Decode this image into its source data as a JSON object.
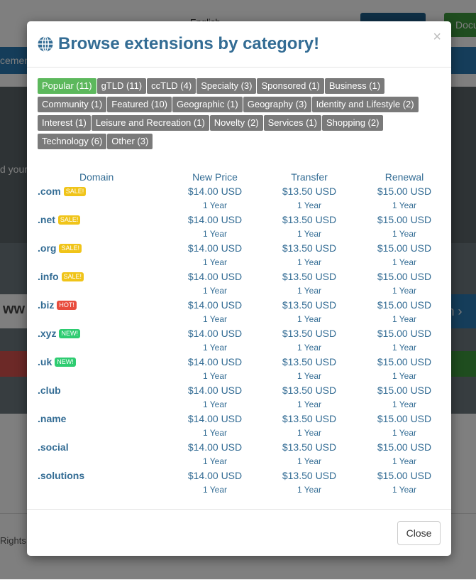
{
  "background": {
    "nav_text": "cement",
    "language_text": "English",
    "docs_button": "Docu",
    "hero_text": "d your",
    "search_text": "ww",
    "search_go": "h ›",
    "footer_text": "Rights"
  },
  "modal": {
    "title": "Browse extensions by category!",
    "close_icon": "×",
    "categories": [
      {
        "label": "Popular (11)",
        "active": true
      },
      {
        "label": "gTLD (11)",
        "active": false
      },
      {
        "label": "ccTLD (4)",
        "active": false
      },
      {
        "label": "Specialty (3)",
        "active": false
      },
      {
        "label": "Sponsored (1)",
        "active": false
      },
      {
        "label": "Business (1)",
        "active": false
      },
      {
        "label": "Community (1)",
        "active": false
      },
      {
        "label": "Featured (10)",
        "active": false
      },
      {
        "label": "Geographic (1)",
        "active": false
      },
      {
        "label": "Geography (3)",
        "active": false
      },
      {
        "label": "Identity and Lifestyle (2)",
        "active": false
      },
      {
        "label": "Interest (1)",
        "active": false
      },
      {
        "label": "Leisure and Recreation (1)",
        "active": false
      },
      {
        "label": "Novelty (2)",
        "active": false
      },
      {
        "label": "Services (1)",
        "active": false
      },
      {
        "label": "Shopping (2)",
        "active": false
      },
      {
        "label": "Technology (6)",
        "active": false
      },
      {
        "label": "Other (3)",
        "active": false
      }
    ],
    "table": {
      "headers": {
        "domain": "Domain",
        "new_price": "New Price",
        "transfer": "Transfer",
        "renewal": "Renewal"
      },
      "rows": [
        {
          "tld": ".com",
          "badge": "SALE!",
          "badge_type": "sale",
          "new_price": "$14.00 USD",
          "new_term": "1 Year",
          "transfer": "$13.50 USD",
          "transfer_term": "1 Year",
          "renewal": "$15.00 USD",
          "renewal_term": "1 Year"
        },
        {
          "tld": ".net",
          "badge": "SALE!",
          "badge_type": "sale",
          "new_price": "$14.00 USD",
          "new_term": "1 Year",
          "transfer": "$13.50 USD",
          "transfer_term": "1 Year",
          "renewal": "$15.00 USD",
          "renewal_term": "1 Year"
        },
        {
          "tld": ".org",
          "badge": "SALE!",
          "badge_type": "sale",
          "new_price": "$14.00 USD",
          "new_term": "1 Year",
          "transfer": "$13.50 USD",
          "transfer_term": "1 Year",
          "renewal": "$15.00 USD",
          "renewal_term": "1 Year"
        },
        {
          "tld": ".info",
          "badge": "SALE!",
          "badge_type": "sale",
          "new_price": "$14.00 USD",
          "new_term": "1 Year",
          "transfer": "$13.50 USD",
          "transfer_term": "1 Year",
          "renewal": "$15.00 USD",
          "renewal_term": "1 Year"
        },
        {
          "tld": ".biz",
          "badge": "HOT!",
          "badge_type": "hot",
          "new_price": "$14.00 USD",
          "new_term": "1 Year",
          "transfer": "$13.50 USD",
          "transfer_term": "1 Year",
          "renewal": "$15.00 USD",
          "renewal_term": "1 Year"
        },
        {
          "tld": ".xyz",
          "badge": "NEW!",
          "badge_type": "new",
          "new_price": "$14.00 USD",
          "new_term": "1 Year",
          "transfer": "$13.50 USD",
          "transfer_term": "1 Year",
          "renewal": "$15.00 USD",
          "renewal_term": "1 Year"
        },
        {
          "tld": ".uk",
          "badge": "NEW!",
          "badge_type": "new",
          "new_price": "$14.00 USD",
          "new_term": "1 Year",
          "transfer": "$13.50 USD",
          "transfer_term": "1 Year",
          "renewal": "$15.00 USD",
          "renewal_term": "1 Year"
        },
        {
          "tld": ".club",
          "badge": "",
          "badge_type": "",
          "new_price": "$14.00 USD",
          "new_term": "1 Year",
          "transfer": "$13.50 USD",
          "transfer_term": "1 Year",
          "renewal": "$15.00 USD",
          "renewal_term": "1 Year"
        },
        {
          "tld": ".name",
          "badge": "",
          "badge_type": "",
          "new_price": "$14.00 USD",
          "new_term": "1 Year",
          "transfer": "$13.50 USD",
          "transfer_term": "1 Year",
          "renewal": "$15.00 USD",
          "renewal_term": "1 Year"
        },
        {
          "tld": ".social",
          "badge": "",
          "badge_type": "",
          "new_price": "$14.00 USD",
          "new_term": "1 Year",
          "transfer": "$13.50 USD",
          "transfer_term": "1 Year",
          "renewal": "$15.00 USD",
          "renewal_term": "1 Year"
        },
        {
          "tld": ".solutions",
          "badge": "",
          "badge_type": "",
          "new_price": "$14.00 USD",
          "new_term": "1 Year",
          "transfer": "$13.50 USD",
          "transfer_term": "1 Year",
          "renewal": "$15.00 USD",
          "renewal_term": "1 Year"
        }
      ]
    },
    "close_button": "Close"
  },
  "colors": {
    "title": "#336c94",
    "active_category": "#5cb85c",
    "category": "#7a7a7a",
    "badge_sale": "#f0c419",
    "badge_hot": "#e84c3d",
    "badge_new": "#2ecc71"
  },
  "icons": {
    "title_icon": "globe-icon",
    "close": "close-icon"
  }
}
